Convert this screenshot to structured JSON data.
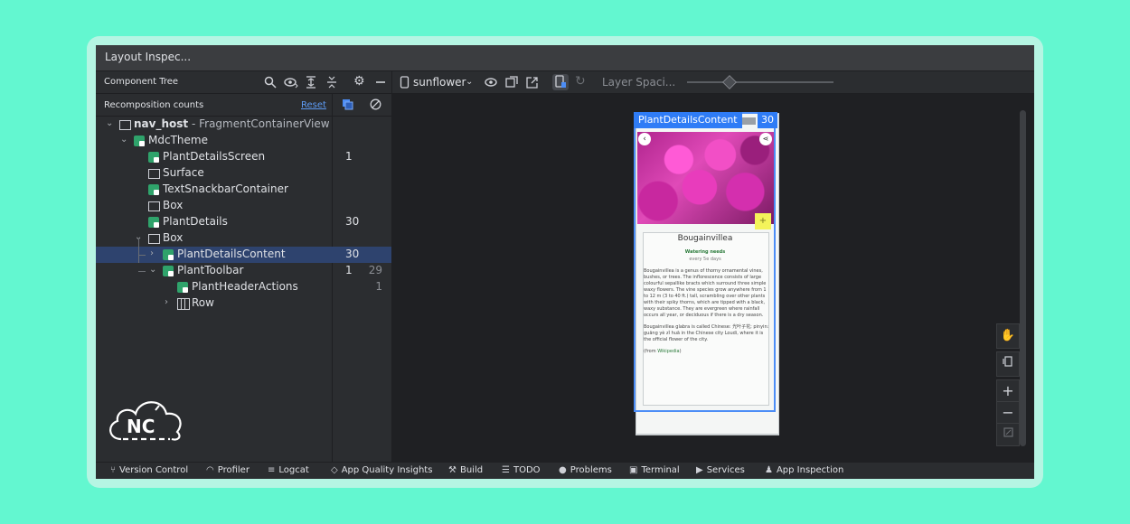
{
  "window": {
    "title": "Layout Inspec..."
  },
  "component_tree": {
    "label": "Component Tree",
    "icons": [
      "search-icon",
      "eye-icon",
      "expand-all-icon",
      "collapse-all-icon",
      "gear-icon",
      "minimize-icon"
    ]
  },
  "recomposition": {
    "label": "Recomposition counts",
    "reset_label": "Reset",
    "icons": [
      "copy-icon",
      "skip-icon"
    ]
  },
  "tree": [
    {
      "name_bold": "nav_host",
      "name_rest": " - FragmentContainerView",
      "icon": "view-icon",
      "expanded": true,
      "count": "",
      "skips": ""
    },
    {
      "name": "MdcTheme",
      "icon": "compose-icon",
      "expanded": true,
      "count": "",
      "skips": ""
    },
    {
      "name": "PlantDetailsScreen",
      "icon": "compose-icon",
      "count": "1",
      "skips": ""
    },
    {
      "name": "Surface",
      "icon": "box-icon",
      "count": "",
      "skips": ""
    },
    {
      "name": "TextSnackbarContainer",
      "icon": "compose-icon",
      "count": "",
      "skips": ""
    },
    {
      "name": "Box",
      "icon": "box-icon",
      "count": "",
      "skips": ""
    },
    {
      "name": "PlantDetails",
      "icon": "compose-icon",
      "count": "30",
      "skips": ""
    },
    {
      "name": "Box",
      "icon": "box-icon",
      "expanded": true,
      "count": "",
      "skips": ""
    },
    {
      "name": "PlantDetailsContent",
      "icon": "compose-icon",
      "collapsed": true,
      "selected": true,
      "count": "30",
      "skips": ""
    },
    {
      "name": "PlantToolbar",
      "icon": "compose-icon",
      "expanded": true,
      "count": "1",
      "skips": "29"
    },
    {
      "name": "PlantHeaderActions",
      "icon": "compose-icon",
      "count": "",
      "skips": "1"
    },
    {
      "name": "Row",
      "icon": "row-icon",
      "collapsed": true,
      "count": "",
      "skips": ""
    }
  ],
  "logo": {
    "text": "NC"
  },
  "toolbar": {
    "device": "sunflower",
    "layer_spacing": "Layer Spaci..."
  },
  "preview": {
    "selected_label": "PlantDetailsContent",
    "selected_count": "30",
    "plant_name": "Bougainvillea",
    "watering_title": "Watering needs",
    "watering_value": "every 5e days",
    "description_1": "Bougainvillea is a genus of thorny ornamental vines, bushes, or trees. The inflorescence consists of large colourful sepallike bracts which surround three simple waxy flowers. The vine species grow anywhere from 1 to 12 m (3 to 40 ft.) tall, scrambling over other plants with their spiky thorns, which are tipped with a black, waxy substance. They are evergreen where rainfall occurs all year, or deciduous if there is a dry season.",
    "description_2": "Bougainvillea glabra is called Chinese: 光叶子花; pinyin: guāng yè zǐ huā in the Chinese city Loudi, where it is the official flower of the city.",
    "wiki_prefix": "(from ",
    "wiki_link": "Wikipedia",
    "wiki_suffix": ")"
  },
  "right_controls": [
    "pan-icon",
    "layers-icon",
    "zoom-in-icon",
    "zoom-out-icon",
    "fit-icon"
  ],
  "statusbar": [
    {
      "icon": "branch-icon",
      "label": "Version Control"
    },
    {
      "icon": "gauge-icon",
      "label": "Profiler"
    },
    {
      "icon": "list-icon",
      "label": "Logcat"
    },
    {
      "icon": "diamond-icon",
      "label": "App Quality Insights"
    },
    {
      "icon": "hammer-icon",
      "label": "Build"
    },
    {
      "icon": "todo-icon",
      "label": "TODO"
    },
    {
      "icon": "alert-icon",
      "label": "Problems"
    },
    {
      "icon": "terminal-icon",
      "label": "Terminal"
    },
    {
      "icon": "play-icon",
      "label": "Services"
    },
    {
      "icon": "android-icon",
      "label": "App Inspection"
    }
  ]
}
